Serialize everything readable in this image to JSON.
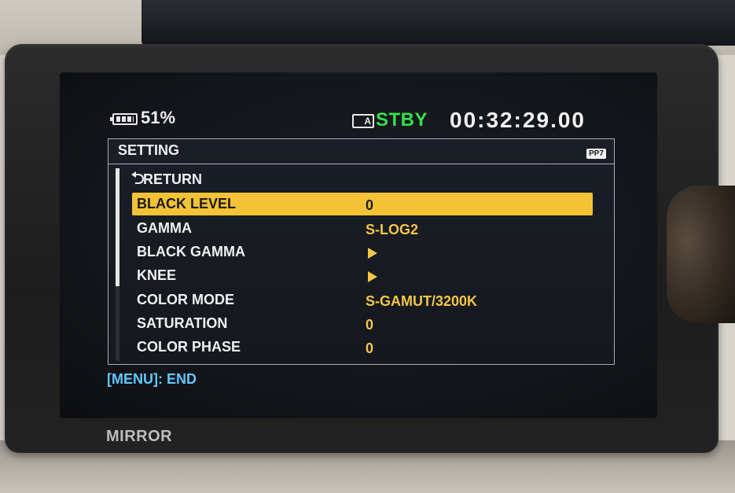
{
  "status": {
    "battery_icon": "battery-icon",
    "battery_percent": "51%",
    "media_icon": "media-slot-a-icon",
    "media_slot": "A",
    "record_state": "STBY",
    "record_state_color": "#35e04a",
    "timecode": "00:32:29.00"
  },
  "menu": {
    "title": "SETTING",
    "badge": "PP7",
    "return_label": "RETURN",
    "selected_color": "#f3c236",
    "value_color": "#f5c544",
    "items": [
      {
        "label": "BLACK LEVEL",
        "value": "0",
        "selected": true
      },
      {
        "label": "GAMMA",
        "value": "S-LOG2"
      },
      {
        "label": "BLACK GAMMA",
        "value": "",
        "submenu_icon": "arrow-right-icon"
      },
      {
        "label": "KNEE",
        "value": "",
        "submenu_icon": "arrow-right-icon"
      },
      {
        "label": "COLOR MODE",
        "value": "S-GAMUT/3200K"
      },
      {
        "label": "SATURATION",
        "value": "0"
      },
      {
        "label": "COLOR PHASE",
        "value": "0"
      }
    ]
  },
  "footer": {
    "hint": "[MENU]: END",
    "hint_color": "#5fc8ff"
  },
  "device": {
    "mirror_label": "MIRROR"
  }
}
